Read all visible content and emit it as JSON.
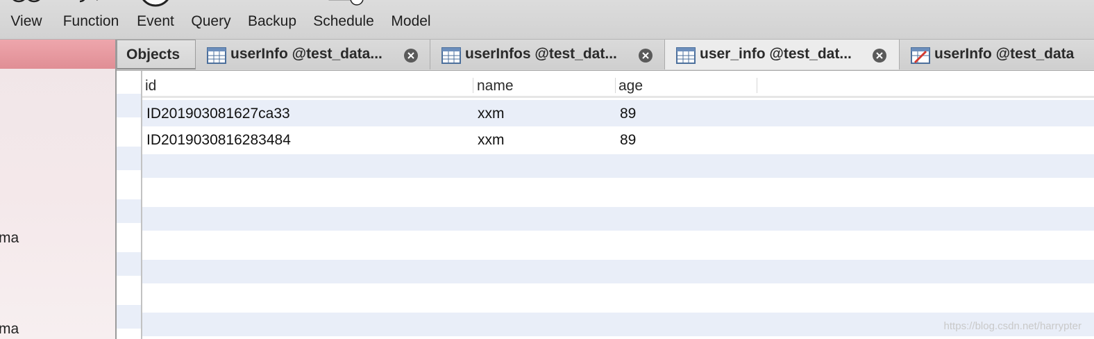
{
  "toolbar": {
    "items": [
      {
        "label": "View",
        "icon": "view-icon"
      },
      {
        "label": "Function",
        "icon": "function-icon"
      },
      {
        "label": "Event",
        "icon": "event-clock-icon"
      },
      {
        "label": "Query",
        "icon": "query-table-icon"
      },
      {
        "label": "Backup",
        "icon": "backup-icon"
      },
      {
        "label": "Schedule",
        "icon": "schedule-icon"
      },
      {
        "label": "Model",
        "icon": "model-icon"
      }
    ]
  },
  "sidebar": {
    "items": [
      {
        "label": "ma"
      },
      {
        "label": "ma"
      }
    ],
    "selected_color": "#e8979d"
  },
  "tabs": [
    {
      "label": "Objects",
      "icon": null,
      "closable": false
    },
    {
      "label": "userInfo @test_data...",
      "icon": "table-icon",
      "closable": true
    },
    {
      "label": "userInfos @test_dat...",
      "icon": "table-icon",
      "closable": true
    },
    {
      "label": "user_info @test_dat...",
      "icon": "table-icon",
      "closable": true,
      "active": true
    },
    {
      "label": "userInfo @test_data",
      "icon": "table-edit-icon",
      "closable": false
    }
  ],
  "grid": {
    "columns": [
      "id",
      "name",
      "age"
    ],
    "rows": [
      [
        "ID201903081627ca33",
        "xxm",
        "89"
      ],
      [
        "ID2019030816283484",
        "xxm",
        "89"
      ]
    ],
    "stripe_color": "#e9eef8"
  },
  "watermark": "https://blog.csdn.net/harrypter"
}
